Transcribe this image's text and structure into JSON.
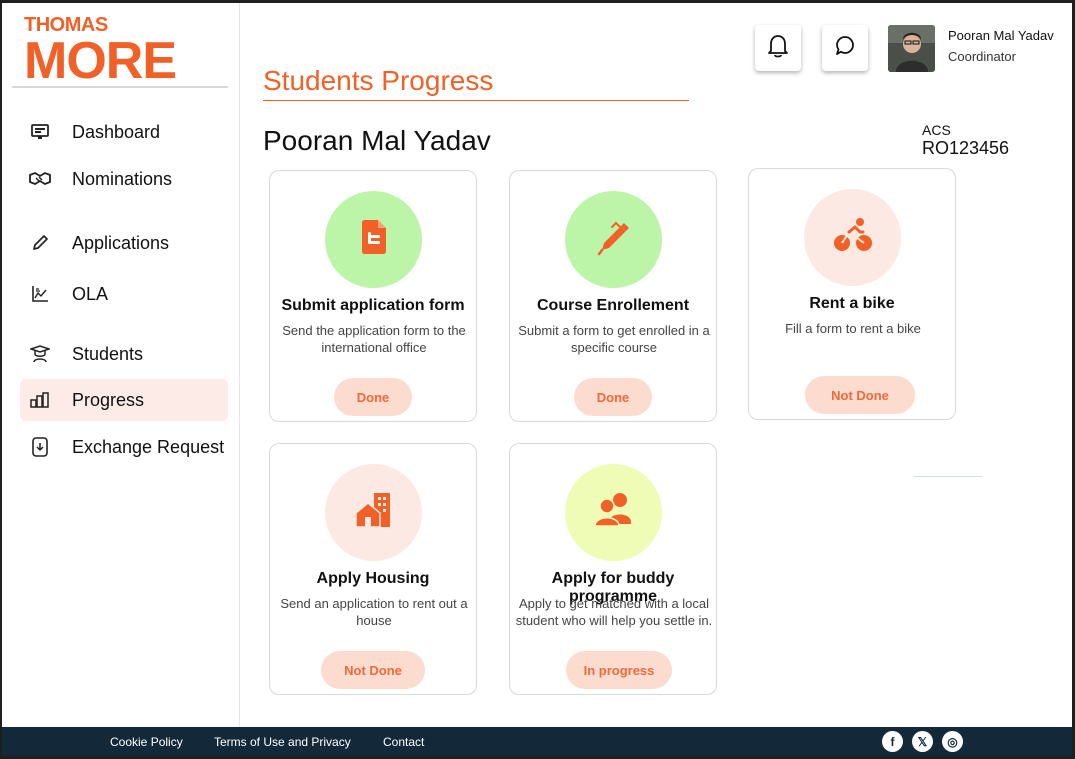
{
  "brand": {
    "line1": "THOMAS",
    "line2": "MORE"
  },
  "sidebar": {
    "items": [
      {
        "label": "Dashboard",
        "icon": "monitor-icon"
      },
      {
        "label": "Nominations",
        "icon": "handshake-icon"
      },
      {
        "label": "Applications",
        "icon": "pencil-icon"
      },
      {
        "label": "OLA",
        "icon": "chart-icon"
      },
      {
        "label": "Students",
        "icon": "graduate-icon"
      },
      {
        "label": "Progress",
        "icon": "bar-chart-icon",
        "active": true
      },
      {
        "label": "Exchange Request",
        "icon": "download-file-icon"
      }
    ]
  },
  "header": {
    "page_title": "Students Progress",
    "user_name": "Pooran Mal Yadav",
    "user_role": "Coordinator"
  },
  "student": {
    "name": "Pooran Mal Yadav",
    "programme": "ACS",
    "id": "RO123456"
  },
  "cards": [
    {
      "title": "Submit application form",
      "description": "Send the application form to the international office",
      "status": "Done",
      "icon": "document-icon",
      "circle_color": "#bdf5a8"
    },
    {
      "title": "Course Enrollement",
      "description": "Submit a form to get enrolled in a specific course",
      "status": "Done",
      "icon": "pen-icon",
      "circle_color": "#bdf5a8"
    },
    {
      "title": "Rent a bike",
      "description": "Fill a form to rent a bike",
      "status": "Not Done",
      "icon": "bicycle-icon",
      "circle_color": "#fde9e3"
    },
    {
      "title": "Apply Housing",
      "description": "Send an application to rent out a house",
      "status": "Not Done",
      "icon": "house-icon",
      "circle_color": "#fde9e3"
    },
    {
      "title": "Apply for buddy programme",
      "description": "Apply to get matched with a local student who will help you settle in.",
      "status": "In progress",
      "icon": "people-icon",
      "circle_color": "#eefcb5"
    }
  ],
  "footer": {
    "links": [
      "Cookie Policy",
      "Terms of Use and Privacy",
      "Contact"
    ],
    "social": [
      {
        "icon": "facebook-icon",
        "glyph": "f"
      },
      {
        "icon": "x-icon",
        "glyph": "𝕏"
      },
      {
        "icon": "instagram-icon",
        "glyph": "◎"
      }
    ]
  },
  "colors": {
    "accent": "#f16127",
    "footer_bg": "#13293a",
    "active_bg": "#fdebe7",
    "status_bg": "#fddcd0"
  }
}
